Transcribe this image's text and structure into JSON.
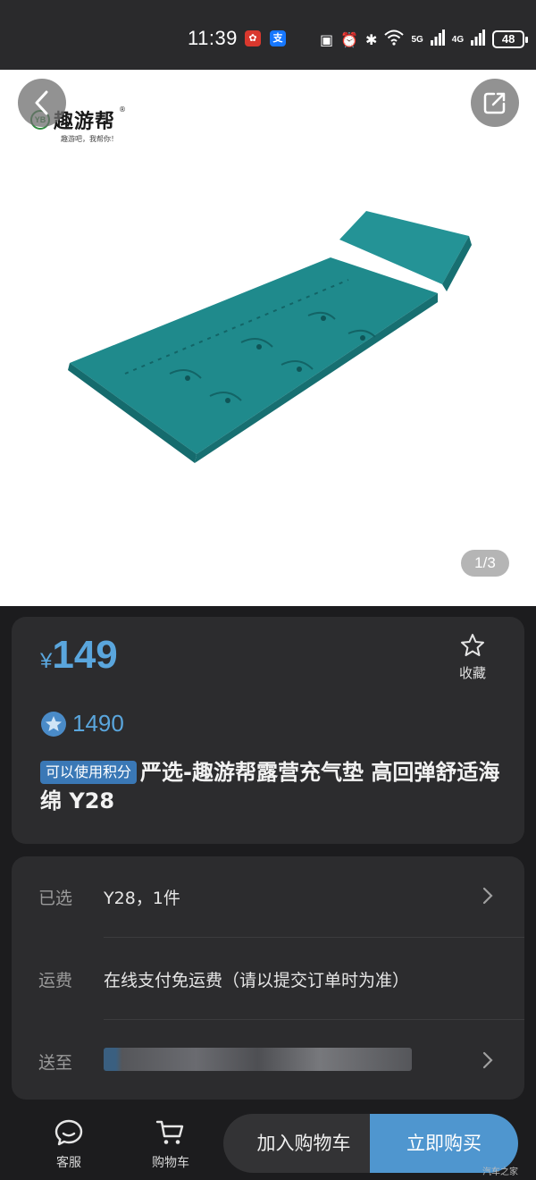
{
  "status_bar": {
    "time": "11:39",
    "battery": "48",
    "network_5g": "5G",
    "network_4g": "4G"
  },
  "hero": {
    "brand_name": "趣游帮",
    "brand_badge": "YB",
    "brand_slogan": "趣游吧，我帮你！",
    "page_indicator": "1/3",
    "image_subject": "teal-inflatable-camping-mat"
  },
  "product": {
    "currency": "¥",
    "price": "149",
    "favorite_label": "收藏",
    "points": "1490",
    "points_tag": "可以使用积分",
    "title": "严选-趣游帮露营充气垫 高回弹舒适海绵 Y28"
  },
  "details": {
    "selected_label": "已选",
    "selected_value": "Y28，1件",
    "shipping_label": "运费",
    "shipping_value": "在线支付免运费（请以提交订单时为准）",
    "delivery_label": "送至"
  },
  "bottom_bar": {
    "service_label": "客服",
    "cart_label": "购物车",
    "add_to_cart": "加入购物车",
    "buy_now": "立即购买"
  },
  "watermark": "汽车之家",
  "colors": {
    "accent": "#5aa6dd",
    "buy_button": "#4f96cf",
    "tag": "#3a78b6",
    "card": "#2c2c2e",
    "background": "#1c1c1e",
    "mat": "#1f8a8c"
  }
}
